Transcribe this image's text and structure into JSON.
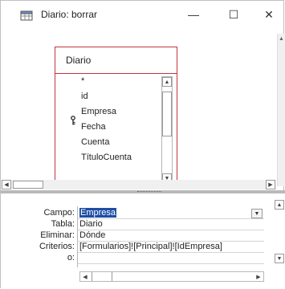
{
  "window": {
    "title": "Diario: borrar",
    "minimize_glyph": "—",
    "maximize_glyph": "☐",
    "close_glyph": "✕"
  },
  "table": {
    "name": "Diario",
    "fields": [
      "*",
      "id",
      "Empresa",
      "Fecha",
      "Cuenta",
      "TítuloCuenta"
    ],
    "key_field": "id"
  },
  "grid": {
    "row_labels": {
      "campo": "Campo:",
      "tabla": "Tabla:",
      "eliminar": "Eliminar:",
      "criterios": "Criterios:",
      "o": "o:"
    },
    "column": {
      "campo": "Empresa",
      "tabla": "Diario",
      "eliminar": "Dónde",
      "criterios": "[Formularios]![Principal]![IdEmpresa]",
      "o": ""
    }
  },
  "icons": {
    "title": "query-table-icon",
    "key": "primary-key-icon"
  }
}
